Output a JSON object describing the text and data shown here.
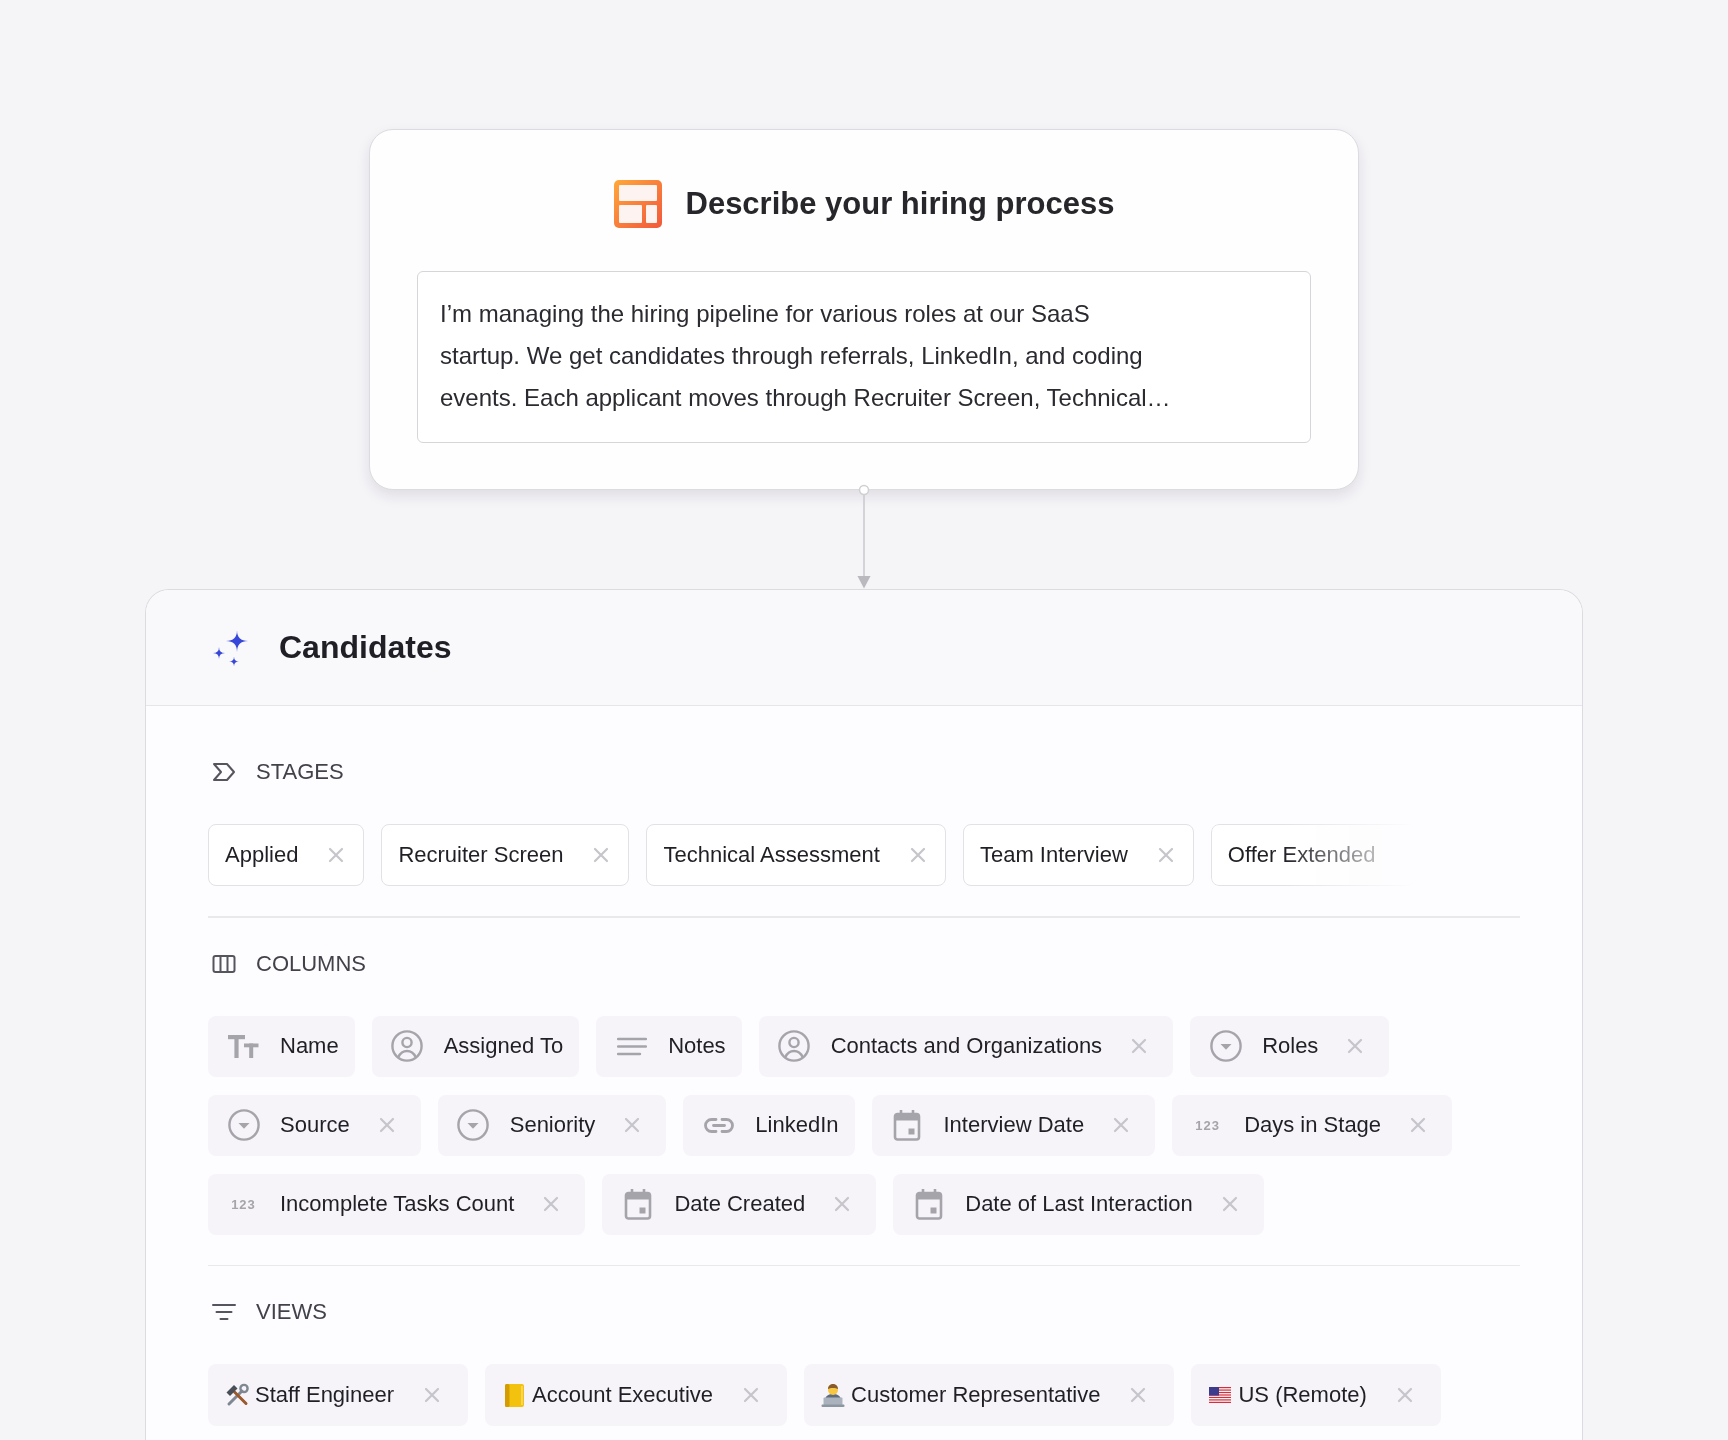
{
  "prompt_card": {
    "title": "Describe your hiring process",
    "description": "I’m managing the hiring pipeline for various roles at our SaaS\nstartup. We get candidates through referrals, LinkedIn, and coding\nevents. Each applicant moves through Recruiter Screen, Technical…"
  },
  "object_card": {
    "title": "Candidates",
    "stages": {
      "heading": "STAGES",
      "items": [
        {
          "label": "Applied",
          "removable": true,
          "faded": false
        },
        {
          "label": "Recruiter Screen",
          "removable": true,
          "faded": false
        },
        {
          "label": "Technical Assessment",
          "removable": true,
          "faded": false
        },
        {
          "label": "Team Interview",
          "removable": true,
          "faded": false
        },
        {
          "label": "Offer Extended",
          "removable": false,
          "faded": true
        }
      ]
    },
    "columns": {
      "heading": "COLUMNS",
      "items": [
        {
          "label": "Name",
          "kind": "text",
          "removable": false
        },
        {
          "label": "Assigned To",
          "kind": "person",
          "removable": false
        },
        {
          "label": "Notes",
          "kind": "long_text",
          "removable": false
        },
        {
          "label": "Contacts and Organizations",
          "kind": "person",
          "removable": true
        },
        {
          "label": "Roles",
          "kind": "select",
          "removable": true
        },
        {
          "label": "Source",
          "kind": "select",
          "removable": true
        },
        {
          "label": "Seniority",
          "kind": "select",
          "removable": true
        },
        {
          "label": "LinkedIn",
          "kind": "link",
          "removable": false
        },
        {
          "label": "Interview Date",
          "kind": "date",
          "removable": true
        },
        {
          "label": "Days in Stage",
          "kind": "number",
          "glyph": "123",
          "removable": true
        },
        {
          "label": "Incomplete Tasks Count",
          "kind": "number",
          "glyph": "123",
          "removable": true
        },
        {
          "label": "Date Created",
          "kind": "date",
          "removable": true
        },
        {
          "label": "Date of Last Interaction",
          "kind": "date",
          "removable": true
        }
      ]
    },
    "views": {
      "heading": "VIEWS",
      "items": [
        {
          "label": "Staff Engineer",
          "kind": "tools",
          "removable": true
        },
        {
          "label": "Account Executive",
          "kind": "notebook",
          "removable": true
        },
        {
          "label": "Customer Representative",
          "kind": "technologist",
          "removable": true
        },
        {
          "label": "US (Remote)",
          "kind": "flag",
          "removable": true
        }
      ]
    }
  }
}
